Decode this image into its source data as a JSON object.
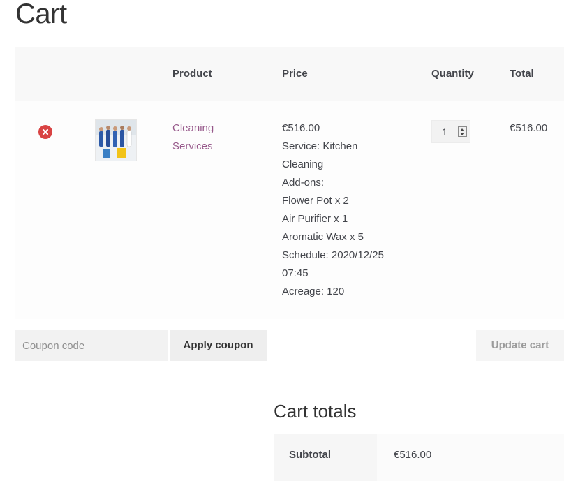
{
  "page": {
    "title": "Cart"
  },
  "table": {
    "headers": {
      "product": "Product",
      "price": "Price",
      "quantity": "Quantity",
      "total": "Total"
    }
  },
  "cart_item": {
    "name_line1": "Cleaning",
    "name_line2": "Services",
    "price": "€516.00",
    "details": [
      "Service: Kitchen",
      "Cleaning",
      "Add-ons:",
      "Flower Pot x 2",
      "Air Purifier x 1",
      "Aromatic Wax x 5",
      "Schedule: 2020/12/25",
      "07:45",
      "Acreage: 120"
    ],
    "quantity": "1",
    "total": "€516.00"
  },
  "actions": {
    "coupon_placeholder": "Coupon code",
    "apply_label": "Apply coupon",
    "update_label": "Update cart"
  },
  "totals": {
    "title": "Cart totals",
    "subtotal_label": "Subtotal",
    "subtotal_value": "€516.00"
  },
  "colors": {
    "link": "#96588a",
    "remove": "#d94343",
    "header_bg": "#f8f8f8"
  },
  "icons": {
    "remove": "remove-circle-x-icon",
    "quantity": "spinner-arrows-icon"
  }
}
